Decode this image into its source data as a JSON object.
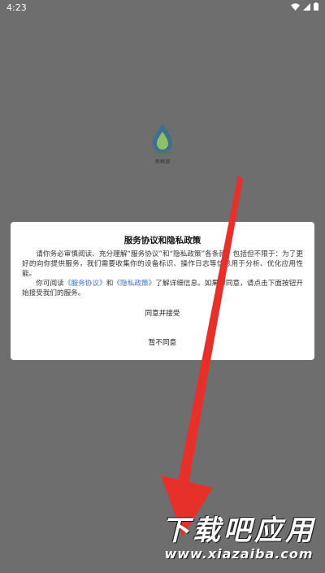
{
  "status_bar": {
    "time": "4:23"
  },
  "app": {
    "name": "新鲜源"
  },
  "dialog": {
    "title": "服务协议和隐私政策",
    "para1": "请你务必审慎阅读、充分理解“服务协议”和“隐私政策”各条款，包括但不限于：为了更好的向你提供服务，我们需要收集你的设备标识、操作日志等信息用于分析、优化应用性能。",
    "para2_prefix": "你可阅读",
    "terms_link": "《服务协议》",
    "para2_and": "和",
    "privacy_link": "《隐私政策》",
    "para2_suffix": "了解详细信息。如果你同意，请点击下面按钮开始接受我们的服务。",
    "agree_label": "同意并接受",
    "disagree_label": "暂不同意"
  },
  "watermark": {
    "title": "下载吧应用",
    "url": "www.xiazaiba.com"
  },
  "colors": {
    "overlay": "#6e6e6e",
    "link": "#3c6fd6",
    "arrow": "#e8302a"
  }
}
